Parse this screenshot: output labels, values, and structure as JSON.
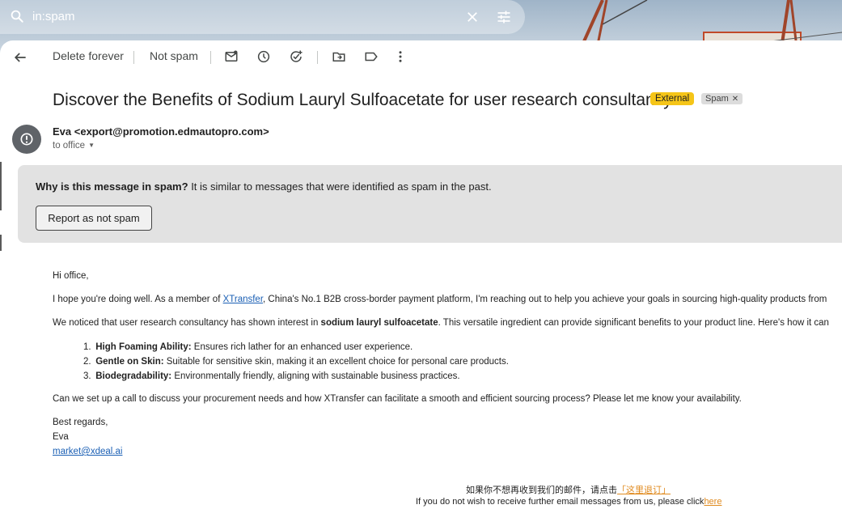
{
  "search": {
    "query": "in:spam"
  },
  "toolbar": {
    "back": "back-arrow-icon",
    "delete_forever": "Delete forever",
    "not_spam": "Not spam",
    "icons": [
      "mark-unread-icon",
      "snooze-icon",
      "add-task-icon",
      "move-to-icon",
      "label-icon",
      "more-icon"
    ]
  },
  "message": {
    "subject": "Discover the Benefits of Sodium Lauryl Sulfoacetate for user research consultancy",
    "badges": {
      "external": "External",
      "spam": "Spam"
    },
    "sender": "Eva <export@promotion.edmautopro.com>",
    "to": "to office"
  },
  "spam_notice": {
    "title": "Why is this message in spam?",
    "text": "It is similar to messages that were identified as spam in the past.",
    "button": "Report as not spam"
  },
  "body": {
    "greeting": "Hi office,",
    "p1_pre": "I hope you're doing well. As a member of ",
    "p1_link": "XTransfer",
    "p1_post": ", China's No.1 B2B cross-border payment platform, I'm reaching out to help you achieve your goals in sourcing high-quality products from",
    "p2_pre": "We noticed that user research consultancy has shown interest in ",
    "p2_bold": "sodium lauryl sulfoacetate",
    "p2_post": ". This versatile ingredient can provide significant benefits to your product line. Here's how it can",
    "list": [
      {
        "num": "1.",
        "bold": "High Foaming Ability:",
        "text": " Ensures rich lather for an enhanced user experience."
      },
      {
        "num": "2.",
        "bold": "Gentle on Skin:",
        "text": " Suitable for sensitive skin, making it an excellent choice for personal care products."
      },
      {
        "num": "3.",
        "bold": "Biodegradability:",
        "text": " Environmentally friendly, aligning with sustainable business practices."
      }
    ],
    "p3": "Can we set up a call to discuss your procurement needs and how XTransfer can facilitate a smooth and efficient sourcing process? Please let me know your availability.",
    "closing": "Best regards,",
    "name": "Eva",
    "email": "market@xdeal.ai",
    "unsub_cn_pre": "如果你不想再收到我们的邮件，请点击",
    "unsub_cn_link": "「这里退订」",
    "unsub_en_pre": "If you do not wish to receive further email messages from us, please click",
    "unsub_en_link": "here"
  }
}
